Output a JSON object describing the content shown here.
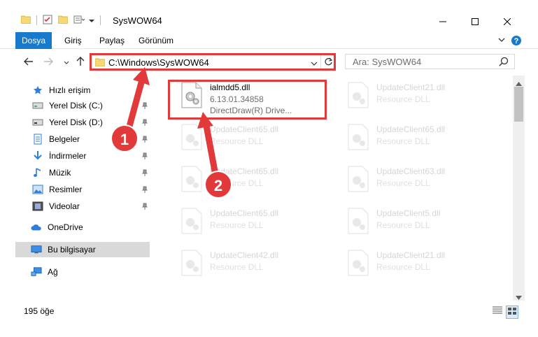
{
  "window": {
    "title": "SysWOW64",
    "minimize": "minimize",
    "maximize": "maximize",
    "close": "close"
  },
  "ribbon": {
    "tabs": [
      "Dosya",
      "Giriş",
      "Paylaş",
      "Görünüm"
    ]
  },
  "address": {
    "path": "C:\\Windows\\SysWOW64"
  },
  "search": {
    "placeholder": "Ara: SysWOW64"
  },
  "nav": {
    "items": [
      {
        "label": "Hızlı erişim",
        "icon": "star-icon",
        "pinned": false
      },
      {
        "label": "Yerel Disk (C:)",
        "icon": "drive-icon",
        "pinned": true
      },
      {
        "label": "Yerel Disk (D:)",
        "icon": "drive-icon",
        "pinned": true
      },
      {
        "label": "Belgeler",
        "icon": "documents-icon",
        "pinned": true
      },
      {
        "label": "İndirmeler",
        "icon": "download-icon",
        "pinned": true
      },
      {
        "label": "Müzik",
        "icon": "music-icon",
        "pinned": true
      },
      {
        "label": "Resimler",
        "icon": "pictures-icon",
        "pinned": true
      },
      {
        "label": "Videolar",
        "icon": "videos-icon",
        "pinned": true
      },
      {
        "label": "OneDrive",
        "icon": "cloud-icon",
        "pinned": false
      },
      {
        "label": "Bu bilgisayar",
        "icon": "computer-icon",
        "pinned": false
      },
      {
        "label": "Ağ",
        "icon": "network-icon",
        "pinned": false
      }
    ]
  },
  "files": {
    "highlighted": {
      "name": "ialmdd5.dll",
      "version": "6.13.01.34858",
      "description": "DirectDraw(R) Drive..."
    },
    "ghost": [
      {
        "name": "UpdateClient21.dll",
        "description": "Resource DLL"
      },
      {
        "name": "UpdateClient65.dll",
        "description": "Resource DLL"
      },
      {
        "name": "UpdateClient65.dll",
        "description": "Resource DLL"
      },
      {
        "name": "UpdateClient65.dll",
        "description": "Resource DLL"
      },
      {
        "name": "UpdateClient63.dll",
        "description": "Resource DLL"
      },
      {
        "name": "UpdateClient65.dll",
        "description": "Resource DLL"
      },
      {
        "name": "UpdateClient5.dll",
        "description": "Resource DLL"
      },
      {
        "name": "UpdateClient42.dll",
        "description": "Resource DLL"
      },
      {
        "name": "UpdateClient21.dll",
        "description": "Resource DLL"
      }
    ]
  },
  "status": {
    "count": "195 öğe"
  },
  "callouts": {
    "one": "1",
    "two": "2"
  },
  "colors": {
    "accent": "#1979ca",
    "callout": "#e23a3a",
    "selected": "#d9d9d9"
  }
}
